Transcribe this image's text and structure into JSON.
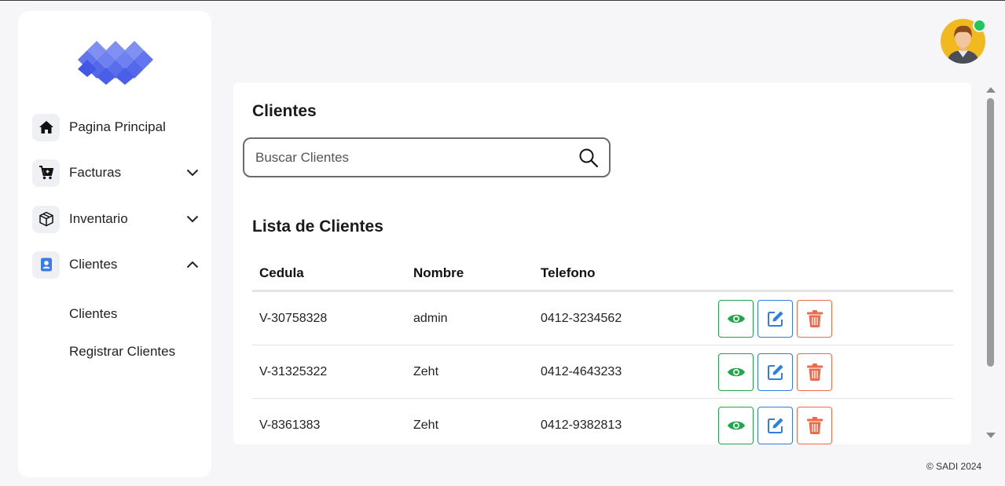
{
  "sidebar": {
    "items": [
      {
        "label": "Pagina Principal",
        "icon": "home-icon"
      },
      {
        "label": "Facturas",
        "icon": "cart-icon",
        "expanded": false
      },
      {
        "label": "Inventario",
        "icon": "box-icon",
        "expanded": false
      },
      {
        "label": "Clientes",
        "icon": "user-badge-icon",
        "expanded": true
      }
    ],
    "subitems": [
      {
        "label": "Clientes"
      },
      {
        "label": "Registrar Clientes"
      }
    ]
  },
  "main": {
    "title": "Clientes",
    "search": {
      "placeholder": "Buscar Clientes"
    },
    "list_title": "Lista de Clientes",
    "table": {
      "headers": [
        "Cedula",
        "Nombre",
        "Telefono"
      ],
      "rows": [
        {
          "cedula": "V-30758328",
          "nombre": "admin",
          "telefono": "0412-3234562"
        },
        {
          "cedula": "V-31325322",
          "nombre": "Zeht",
          "telefono": "0412-4643233"
        },
        {
          "cedula": "V-8361383",
          "nombre": "Zeht",
          "telefono": "0412-9382813"
        }
      ]
    }
  },
  "footer": {
    "text": "© SADI 2024"
  },
  "colors": {
    "accent": "#4f63e8",
    "view": "#1fa74a",
    "edit": "#2f7ee0",
    "delete": "#ef6a4a",
    "online": "#22c55e",
    "avatar_bg": "#f2b91e"
  }
}
